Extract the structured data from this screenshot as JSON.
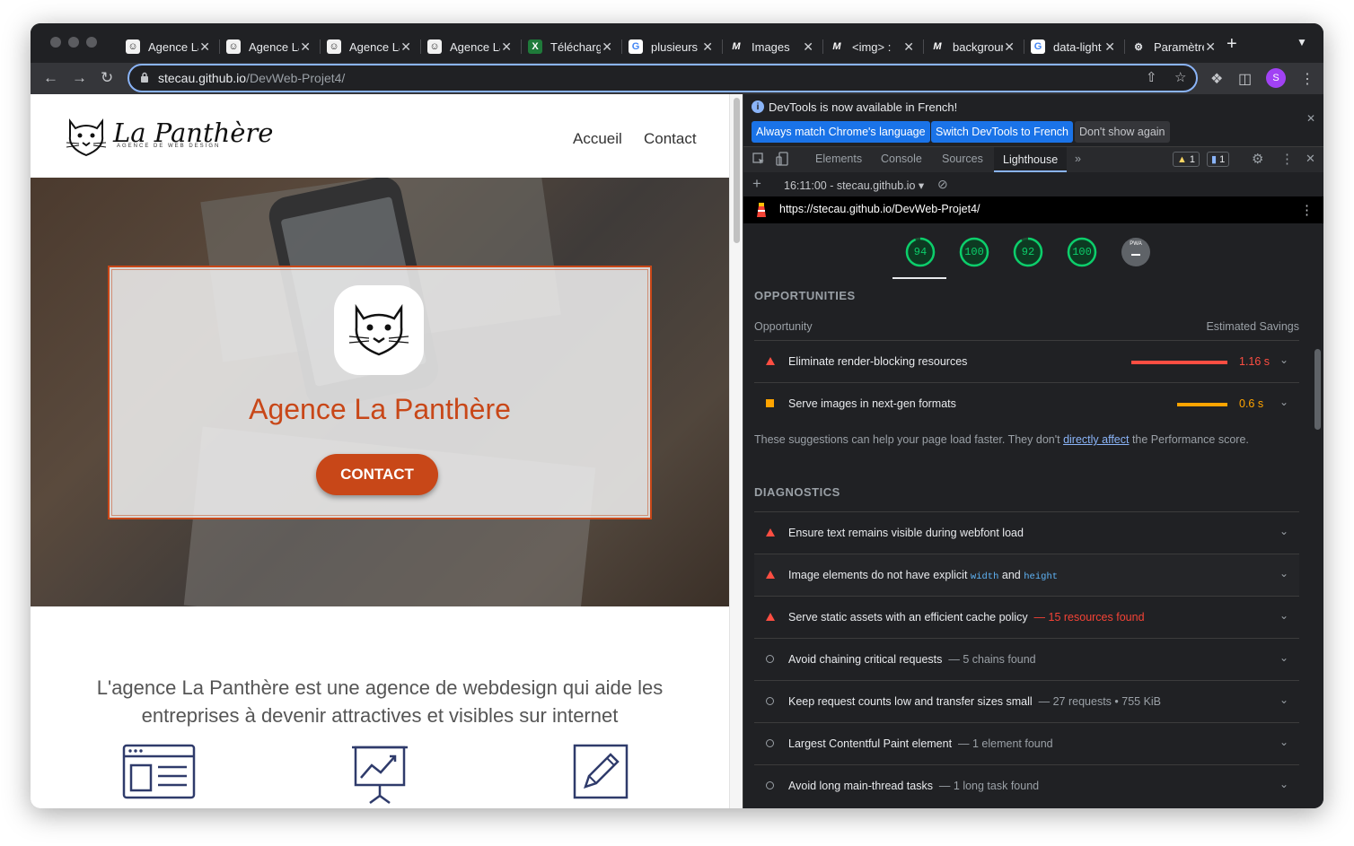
{
  "browser": {
    "tabs": [
      {
        "label": "Agence La Panthère",
        "icon": "panther-favicon"
      },
      {
        "label": "Agence La Panthère",
        "icon": "panther-favicon"
      },
      {
        "label": "Agence La Panthère",
        "icon": "panther-favicon"
      },
      {
        "label": "Agence La Panthère",
        "icon": "panther-favicon"
      },
      {
        "label": "Télécharger",
        "icon": "green-x-favicon"
      },
      {
        "label": "plusieurs",
        "icon": "google-icon"
      },
      {
        "label": "Images",
        "icon": "mdn-icon"
      },
      {
        "label": "<img> :",
        "icon": "mdn-icon"
      },
      {
        "label": "background",
        "icon": "mdn-icon"
      },
      {
        "label": "data-light",
        "icon": "google-icon"
      },
      {
        "label": "Paramètres",
        "icon": "gear-icon"
      }
    ],
    "url_host": "stecau.github.io",
    "url_path": "/DevWeb-Projet4/",
    "profile_initial": "S"
  },
  "site": {
    "logo_name": "La Panthère",
    "logo_tagline": "AGENCE DE WEB DESIGN",
    "nav": [
      "Accueil",
      "Contact"
    ],
    "hero_title": "Agence La Panthère",
    "cta_label": "CONTACT",
    "about_text": "L'agence La Panthère est une agence de webdesign qui aide les entreprises à devenir attractives et visibles sur internet",
    "accent_color": "#c84718"
  },
  "devtools": {
    "infobar_text": "DevTools is now available in French!",
    "infobar_buttons": [
      "Always match Chrome's language",
      "Switch DevTools to French",
      "Don't show again"
    ],
    "tabs": [
      "Elements",
      "Console",
      "Sources",
      "Lighthouse"
    ],
    "active_tab": "Lighthouse",
    "warnings_count": "1",
    "messages_count": "1",
    "report_selector": "16:11:00 - stecau.github.io",
    "report_url": "https://stecau.github.io/DevWeb-Projet4/",
    "scores": [
      {
        "value": "94",
        "fraction": 0.94
      },
      {
        "value": "100",
        "fraction": 1.0
      },
      {
        "value": "92",
        "fraction": 0.92
      },
      {
        "value": "100",
        "fraction": 1.0
      }
    ],
    "pwa_label": "PWA",
    "opportunities_heading": "OPPORTUNITIES",
    "col_opportunity": "Opportunity",
    "col_savings": "Estimated Savings",
    "opportunities": [
      {
        "title": "Eliminate render-blocking resources",
        "savings": "1.16 s",
        "severity": "fail",
        "bar_fraction": 1.0
      },
      {
        "title": "Serve images in next-gen formats",
        "savings": "0.6 s",
        "severity": "average",
        "bar_fraction": 0.52
      }
    ],
    "note_before": "These suggestions can help your page load faster. They don't ",
    "note_link": "directly affect",
    "note_after": " the Performance score.",
    "diagnostics_heading": "DIAGNOSTICS",
    "diagnostics": [
      {
        "title": "Ensure text remains visible during webfont load",
        "detail": "",
        "severity": "fail"
      },
      {
        "title": "Image elements do not have explicit",
        "code1": "width",
        "and_text": "and",
        "code2": "height",
        "severity": "fail"
      },
      {
        "title": "Serve static assets with an efficient cache policy",
        "detail": "— 15 resources found",
        "severity": "fail"
      },
      {
        "title": "Avoid chaining critical requests",
        "detail": "— 5 chains found",
        "severity": "info"
      },
      {
        "title": "Keep request counts low and transfer sizes small",
        "detail": "— 27 requests • 755 KiB",
        "severity": "info"
      },
      {
        "title": "Largest Contentful Paint element",
        "detail": "— 1 element found",
        "severity": "info"
      },
      {
        "title": "Avoid long main-thread tasks",
        "detail": "— 1 long task found",
        "severity": "info"
      }
    ],
    "colors": {
      "pass": "#0cce6b",
      "fail": "#ff4e42",
      "average": "#ffa400"
    }
  }
}
